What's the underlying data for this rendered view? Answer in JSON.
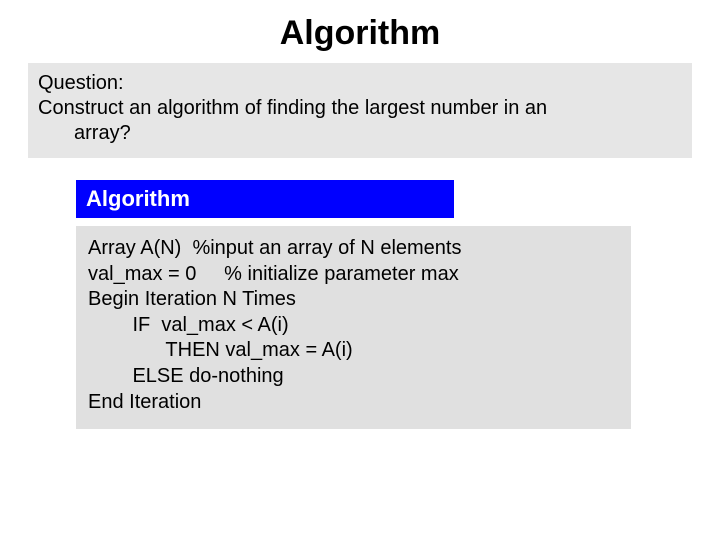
{
  "title": "Algorithm",
  "question": {
    "label": "Question:",
    "text_part1": "Construct an algorithm of finding the largest number in an",
    "text_part2": "array?"
  },
  "algorithm": {
    "header": "Algorithm",
    "lines": {
      "l1": "Array A(N)  %input an array of N elements",
      "l2": "val_max = 0     % initialize parameter max",
      "l3": "",
      "l4": "Begin Iteration N Times",
      "l5": "        IF  val_max < A(i)",
      "l6": "              THEN val_max = A(i)",
      "l7": "        ELSE do-nothing",
      "l8": "End Iteration"
    }
  }
}
